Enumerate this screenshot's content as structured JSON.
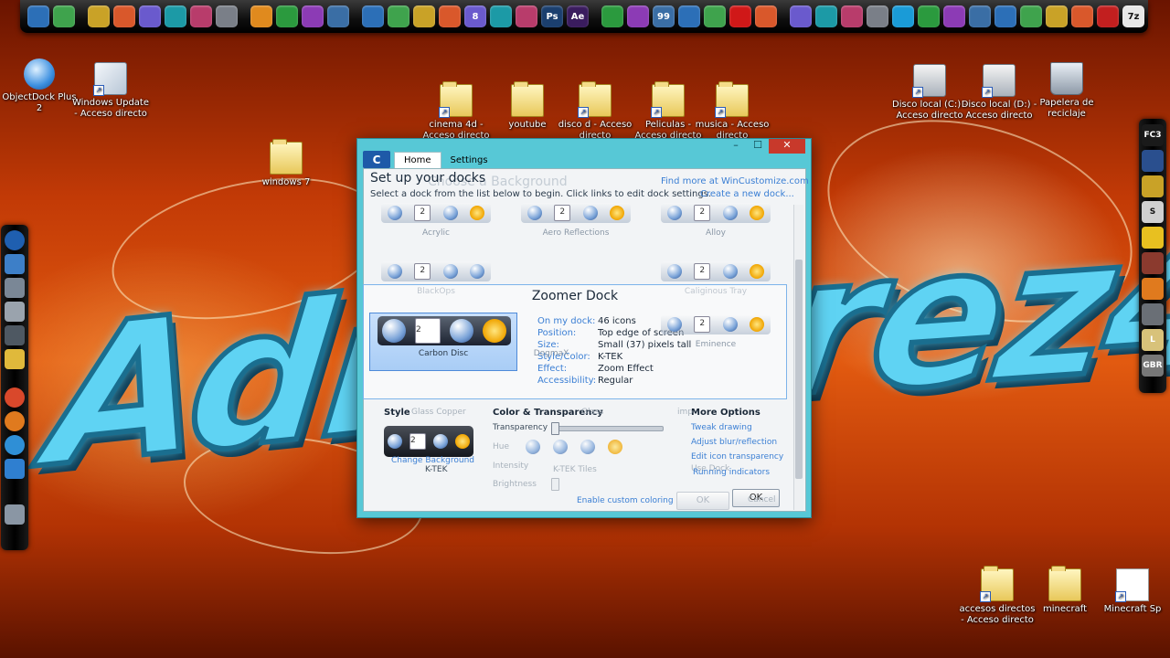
{
  "desktop": {
    "icons": [
      {
        "label": "ObjectDock Plus 2"
      },
      {
        "label": "Windows Update - Acceso directo"
      },
      {
        "label": "cinema 4d - Acceso directo"
      },
      {
        "label": "youtube"
      },
      {
        "label": "disco d - Acceso directo"
      },
      {
        "label": "Peliculas - Acceso directo"
      },
      {
        "label": "musica - Acceso directo"
      },
      {
        "label": "windows 7"
      },
      {
        "label": "Disco local (C:) - Acceso directo"
      },
      {
        "label": "Disco local (D:) - Acceso directo"
      },
      {
        "label": "Papelera de reciclaje"
      },
      {
        "label": "accesos directos - Acceso directo"
      },
      {
        "label": "minecraft"
      },
      {
        "label": "Minecraft Sp"
      }
    ]
  },
  "topdock": {
    "icons": [
      "xnview-icon",
      "utorrent-icon",
      "sep",
      "folder-icon",
      "search-icon",
      "calendar-icon",
      "dvd-icon",
      "media-player-icon",
      "arrow-app-icon",
      "sep",
      "globe-icon",
      "drop-icon",
      "disc-icon",
      "lightning-icon",
      "sep",
      "photoscape-icon",
      "network-icon",
      "monitor-icon",
      "earth-icon",
      "app8-icon",
      "chrome-like-icon",
      "tools-icon",
      "photoshop-icon",
      "aftereffects-icon",
      "sep",
      "play-icon",
      "camera-icon",
      "counter-icon",
      "video-icon",
      "green-icon",
      "record-icon",
      "tv-icon",
      "sep",
      "network-tools-icon",
      "image-icon",
      "paint-icon",
      "upload-icon",
      "skype-icon",
      "cube-icon",
      "palette-icon",
      "reel-icon",
      "itunes-icon",
      "shield-icon",
      "gamepad-icon",
      "settings-icon",
      "pdf-icon",
      "sevenzip-icon"
    ],
    "photoshop_label": "Ps",
    "aftereffects_label": "Ae",
    "counter_label": "99",
    "sevenzip_label": "7z",
    "app8_label": "8"
  },
  "leftdock": {
    "icons": [
      "start-orb-icon",
      "computer-icon",
      "laptop-icon",
      "drive-icon",
      "printer-icon",
      "folder-icon",
      "chrome-icon",
      "firefox-icon",
      "ie-icon",
      "objectdock-icon",
      "recycle-bin-icon"
    ]
  },
  "rightdock": {
    "labels": [
      "FC3",
      "",
      "",
      "S",
      "",
      "",
      "",
      "",
      "L",
      "GBR"
    ]
  },
  "dialog": {
    "app_logo": "C",
    "tabs": [
      {
        "label": "Home"
      },
      {
        "label": "Settings"
      }
    ],
    "win": {
      "minimize": "–",
      "maximize": "☐",
      "close": "✕"
    },
    "header": {
      "title": "Set up your docks",
      "ghost_title": "Choose a Background",
      "subtitle": "Select a dock from the list below to begin. Click links to edit dock settings.",
      "link_more": "Find more at WinCustomize.com",
      "link_create": "Create a new dock..."
    },
    "docks_row1": [
      "Acrylic",
      "Aero Reflections",
      "Alloy"
    ],
    "docks_row2": [
      "BlackOps",
      "Caliginous Tray"
    ],
    "zoomer": {
      "title": "Zoomer Dock",
      "selected_caption": "Carbon Disc",
      "props": [
        {
          "label": "On my dock:",
          "value": "46 icons"
        },
        {
          "label": "Position:",
          "value": "Top edge of screen"
        },
        {
          "label": "Size:",
          "value": "Small (37) pixels tall"
        },
        {
          "label": "Style/Color:",
          "value": "K-TEK"
        },
        {
          "label": "Effect:",
          "value": "Zoom Effect"
        },
        {
          "label": "Accessibility:",
          "value": "Regular"
        }
      ],
      "ghost_dogmax": "DogmaX",
      "ghost_eminence": "Eminence"
    },
    "ghost_glass_copper": "Glass Copper",
    "style": {
      "heading": "Style",
      "preview_caption": "K-TEK",
      "change_bg": "Change Background"
    },
    "color": {
      "heading": "Color & Transparency",
      "transparency": "Transparency",
      "hue": "Hue",
      "intensity": "Intensity",
      "brightness": "Brightness",
      "enable_custom": "Enable custom coloring",
      "ktek_tiles": "K-TEK Tiles",
      "ghost_glass": "Glass"
    },
    "more": {
      "heading": "More Options",
      "links": [
        "Tweak drawing",
        "Adjust blur/reflection",
        "Edit icon transparency",
        "Running indicators"
      ],
      "ghost_use_dock": "Use Dock",
      "ghost_imp": "imp"
    },
    "buttons": {
      "ok_ghost": "OK",
      "ok": "OK",
      "cancel": "Cancel"
    }
  }
}
